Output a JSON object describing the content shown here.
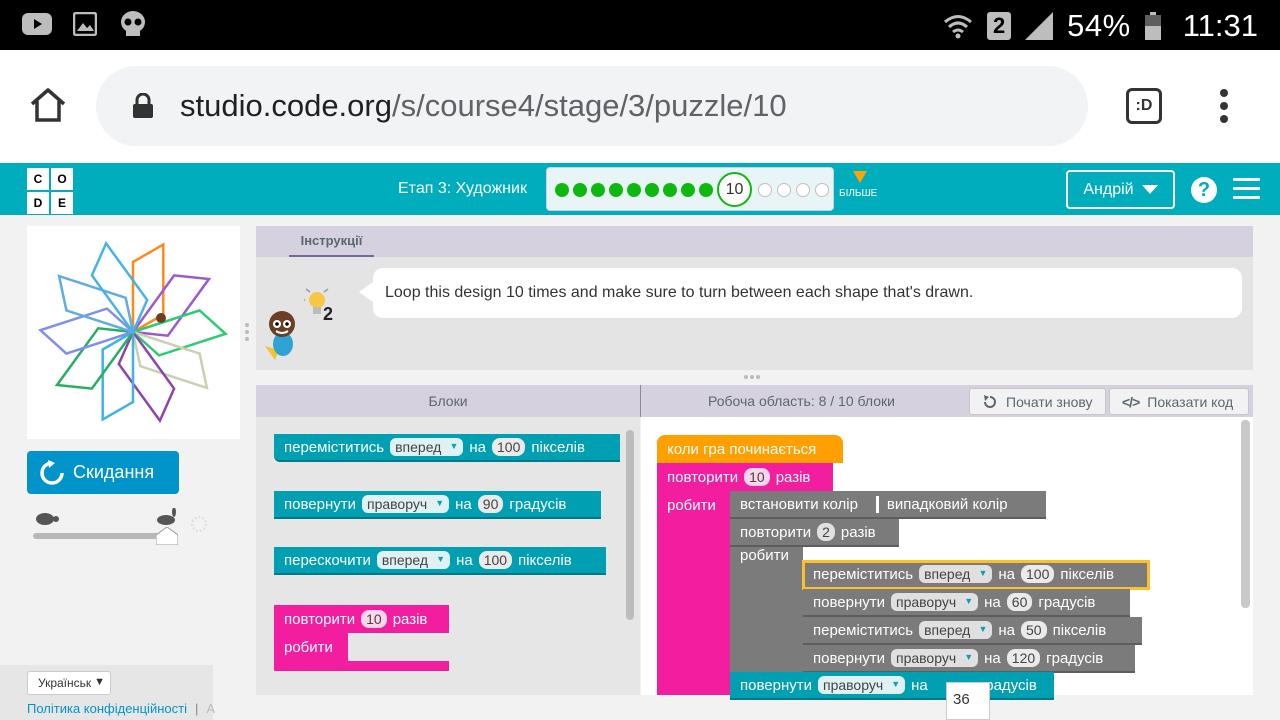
{
  "status_bar": {
    "battery_percent": "54%",
    "time": "11:31",
    "sim_slot": "2",
    "icons": [
      "youtube-icon",
      "gallery-icon",
      "skull-icon",
      "wifi-icon",
      "signal-icon",
      "battery-icon"
    ]
  },
  "browser": {
    "url_host": "studio.code.org",
    "url_path": "/s/course4/stage/3/puzzle/10",
    "home_icon": "home-icon",
    "lock_icon": "lock-icon",
    "tabs_icon": ":D"
  },
  "header": {
    "logo_letters": [
      "C",
      "O",
      "D",
      "E"
    ],
    "stage_title": "Етап 3: Художник",
    "current_level": "10",
    "levels_completed": 9,
    "levels_remaining": 4,
    "more_label": "БІЛЬШЕ",
    "user_name": "Андрій",
    "help_label": "?"
  },
  "left_panel": {
    "reset_label": "Скидання",
    "language": "Українськ",
    "privacy_label": "Політика конфіденційності",
    "privacy_more": "A"
  },
  "instructions": {
    "tab_label": "Інструкції",
    "text": "Loop this design 10 times and make sure to turn between each shape that's drawn.",
    "hint_count": "2"
  },
  "workspace_header": {
    "blocks_label": "Блоки",
    "workspace_label": "Робоча область: 8 / 10 блоки",
    "start_over_label": "Почати знову",
    "show_code_label": "Показати код"
  },
  "toolbox": {
    "move_forward": {
      "prefix": "переміститись",
      "dir": "вперед",
      "on": "на",
      "value": "100",
      "unit": "пікселів"
    },
    "turn_right": {
      "prefix": "повернути",
      "dir": "праворуч",
      "on": "на",
      "value": "90",
      "unit": "градусів"
    },
    "jump_forward": {
      "prefix": "перескочити",
      "dir": "вперед",
      "on": "на",
      "value": "100",
      "unit": "пікселів"
    },
    "repeat": {
      "prefix": "повторити",
      "value": "10",
      "suffix": "разів",
      "do": "робити"
    }
  },
  "program": {
    "when_run": "коли гра починається",
    "repeat_outer": {
      "prefix": "повторити",
      "value": "10",
      "suffix": "разів",
      "do": "робити"
    },
    "set_color": {
      "label": "встановити колір",
      "value": "випадковий колір"
    },
    "repeat_inner": {
      "prefix": "повторити",
      "value": "2",
      "suffix": "разів",
      "do": "робити"
    },
    "inner_blocks": [
      {
        "prefix": "переміститись",
        "dir": "вперед",
        "on": "на",
        "value": "100",
        "unit": "пікселів"
      },
      {
        "prefix": "повернути",
        "dir": "праворуч",
        "on": "на",
        "value": "60",
        "unit": "градусів"
      },
      {
        "prefix": "переміститись",
        "dir": "вперед",
        "on": "на",
        "value": "50",
        "unit": "пікселів"
      },
      {
        "prefix": "повернути",
        "dir": "праворуч",
        "on": "на",
        "value": "120",
        "unit": "градусів"
      }
    ],
    "turn_after": {
      "prefix": "повернути",
      "dir": "праворуч",
      "on": "на",
      "unit": "градусів"
    },
    "number_input_value": "36"
  },
  "colors": {
    "header_teal": "#00adbc",
    "progress_green": "#0eb80e",
    "block_teal": "#00a0b2",
    "block_pink": "#f21e9f",
    "block_orange": "#ff9f00",
    "block_gray": "#7b7b7b"
  }
}
